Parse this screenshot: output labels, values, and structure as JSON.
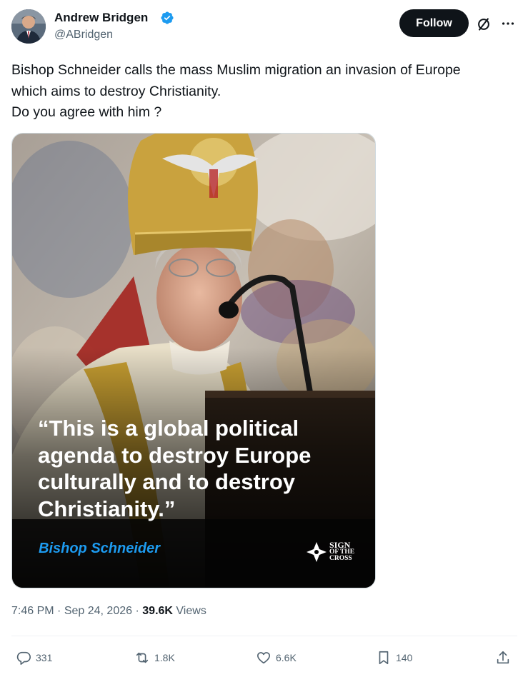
{
  "author": {
    "name": "Andrew Bridgen",
    "handle": "@ABridgen",
    "verified": true
  },
  "header": {
    "follow_label": "Follow"
  },
  "tweet": {
    "lines": [
      "Bishop Schneider calls the mass Muslim migration an invasion of Europe",
      "which aims to destroy Christianity.",
      "Do you agree with him ?"
    ]
  },
  "media": {
    "quote_lines": [
      "“This is a global political",
      "agenda to destroy Europe",
      "culturally and to destroy",
      "Christianity.”"
    ],
    "attribution": "Bishop Schneider",
    "logo_lines": [
      "SIGN",
      "OF THE",
      "CROSS"
    ]
  },
  "meta": {
    "time": "7:46 PM",
    "date": "Sep 24, 2026",
    "views_count": "39.6K",
    "views_label": "Views"
  },
  "actions": {
    "replies": "331",
    "reposts": "1.8K",
    "likes": "6.6K",
    "bookmarks": "140"
  },
  "colors": {
    "accent": "#1d9bf0",
    "text": "#0f1419",
    "muted": "#536471"
  }
}
